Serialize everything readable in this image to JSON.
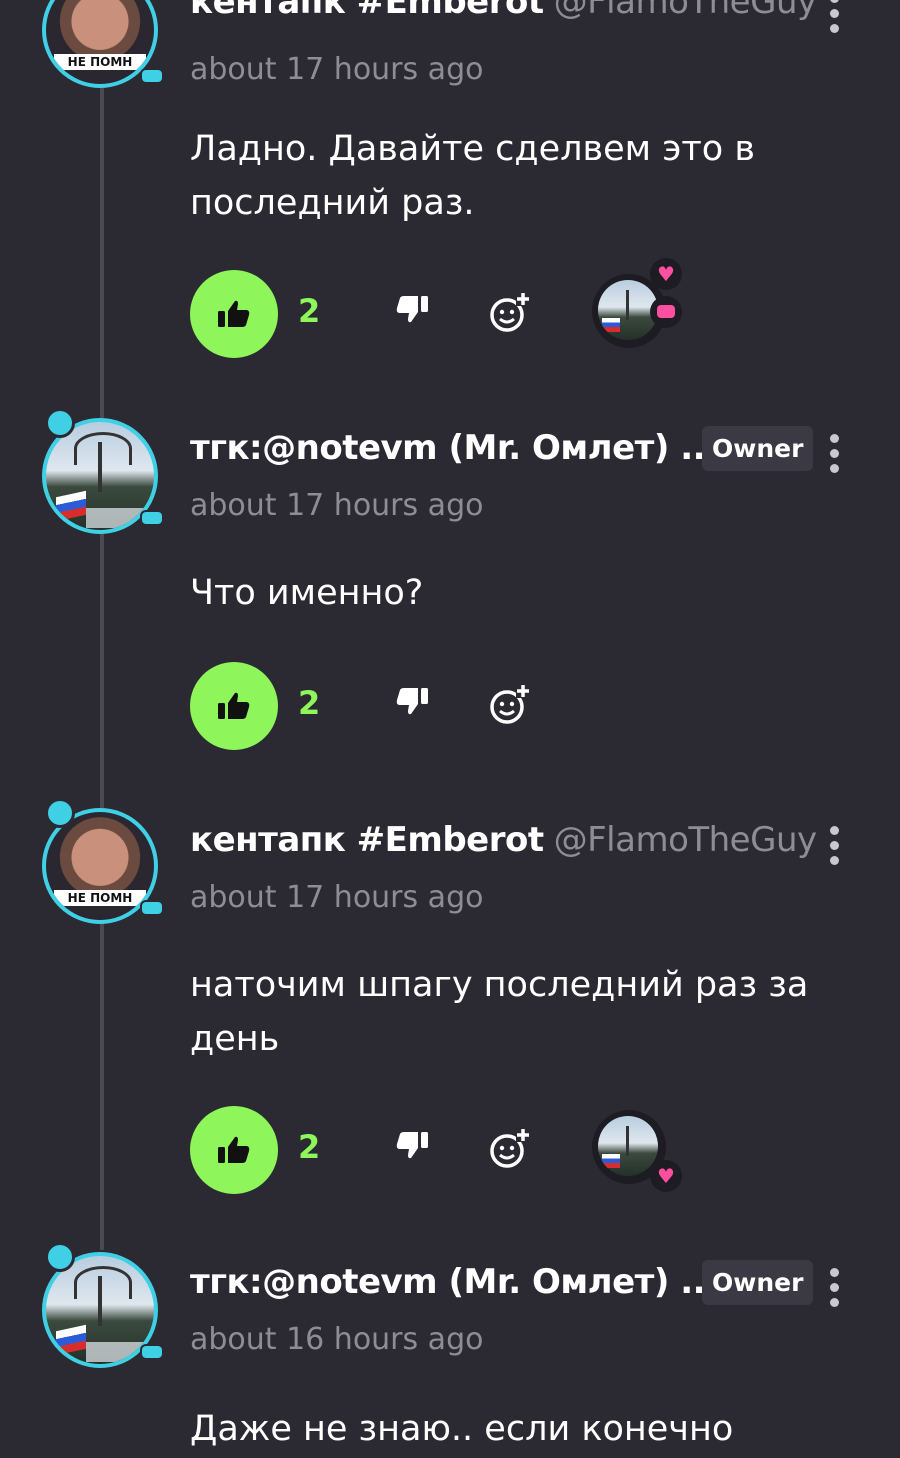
{
  "colors": {
    "background": "#2b2a33",
    "accent_green": "#8ef55a",
    "meta_gray": "#8e8c96",
    "avatar_ring": "#3fd0e6",
    "heart_pink": "#ff4fa0"
  },
  "comments": [
    {
      "author": "кентапк #Emberot",
      "handle": "@FlamoTheGuy",
      "time": "about 17 hours ago",
      "text": "Ладно. Давайте сделвем это в последний раз.",
      "likes": "2",
      "avatar": "face",
      "avatar_caption": "НЕ ПОМН",
      "owner": null,
      "has_reactions": true
    },
    {
      "author": "тгк:@notevm (Mr. Омлет) ...",
      "handle": "",
      "owner": "Owner",
      "time": "about 17 hours ago",
      "text": "Что именно?",
      "likes": "2",
      "avatar": "photo",
      "has_reactions": false
    },
    {
      "author": "кентапк #Emberot",
      "handle": "@FlamoTheGuy",
      "time": "about 17 hours ago",
      "text": "наточим шпагу последний раз за день",
      "likes": "2",
      "avatar": "face",
      "avatar_caption": "НЕ ПОМН",
      "owner": null,
      "has_reactions": true
    },
    {
      "author": "тгк:@notevm (Mr. Омлет) ...",
      "handle": "",
      "owner": "Owner",
      "time": "about 16 hours ago",
      "text": "Даже не знаю.. если конечно",
      "avatar": "photo",
      "has_reactions": false
    }
  ],
  "icons": {
    "like": "thumbs-up-icon",
    "dislike": "thumbs-down-icon",
    "react": "add-reaction-icon",
    "menu": "more-vertical-icon",
    "heart": "heart-icon",
    "chat": "chat-bubble-icon"
  }
}
